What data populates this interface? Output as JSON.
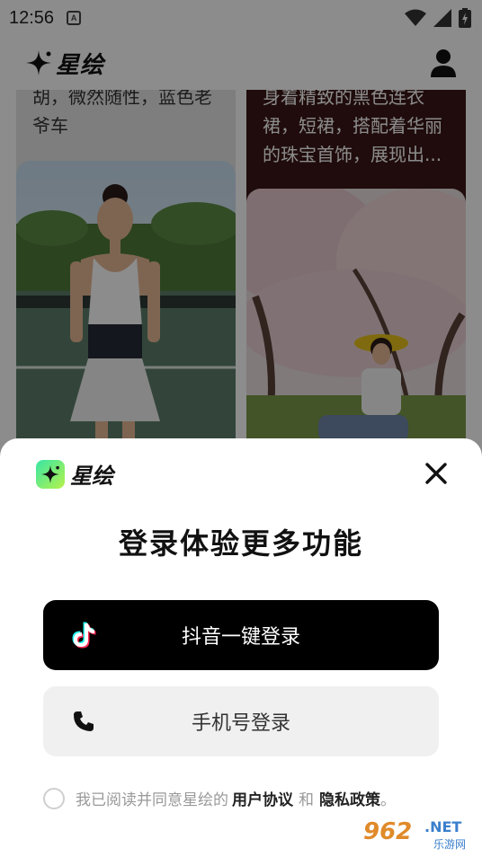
{
  "status_bar": {
    "time": "12:56",
    "notification_icon": "A"
  },
  "app": {
    "title": "星绘",
    "feed": {
      "card_left_text": "胡，微然随性，蓝色老爷车",
      "card_right_text": "身着精致的黑色连衣裙，短裙，搭配着华丽的珠宝首饰，展现出..."
    }
  },
  "login_sheet": {
    "brand": "星绘",
    "title": "登录体验更多功能",
    "douyin_button": "抖音一键登录",
    "phone_button": "手机号登录",
    "agreement": {
      "prefix": "我已阅读并同意星绘的",
      "user_agreement": "用户协议",
      "and": "和",
      "privacy_policy": "隐私政策",
      "suffix": "。"
    }
  },
  "watermark": {
    "number": "962",
    "net": ".NET",
    "caption": "乐游网"
  },
  "colors": {
    "primary_button": "#000000",
    "secondary_button": "#f0f0f0",
    "brand_gradient_start": "#38e6a6",
    "brand_gradient_end": "#b6f24a",
    "dim_overlay": "rgba(0,0,0,0.45)"
  },
  "icons": [
    "sparkle-star-icon",
    "profile-icon",
    "close-icon",
    "douyin-logo-icon",
    "phone-icon",
    "checkbox-circle-icon",
    "wifi-icon",
    "signal-icon",
    "battery-icon"
  ]
}
